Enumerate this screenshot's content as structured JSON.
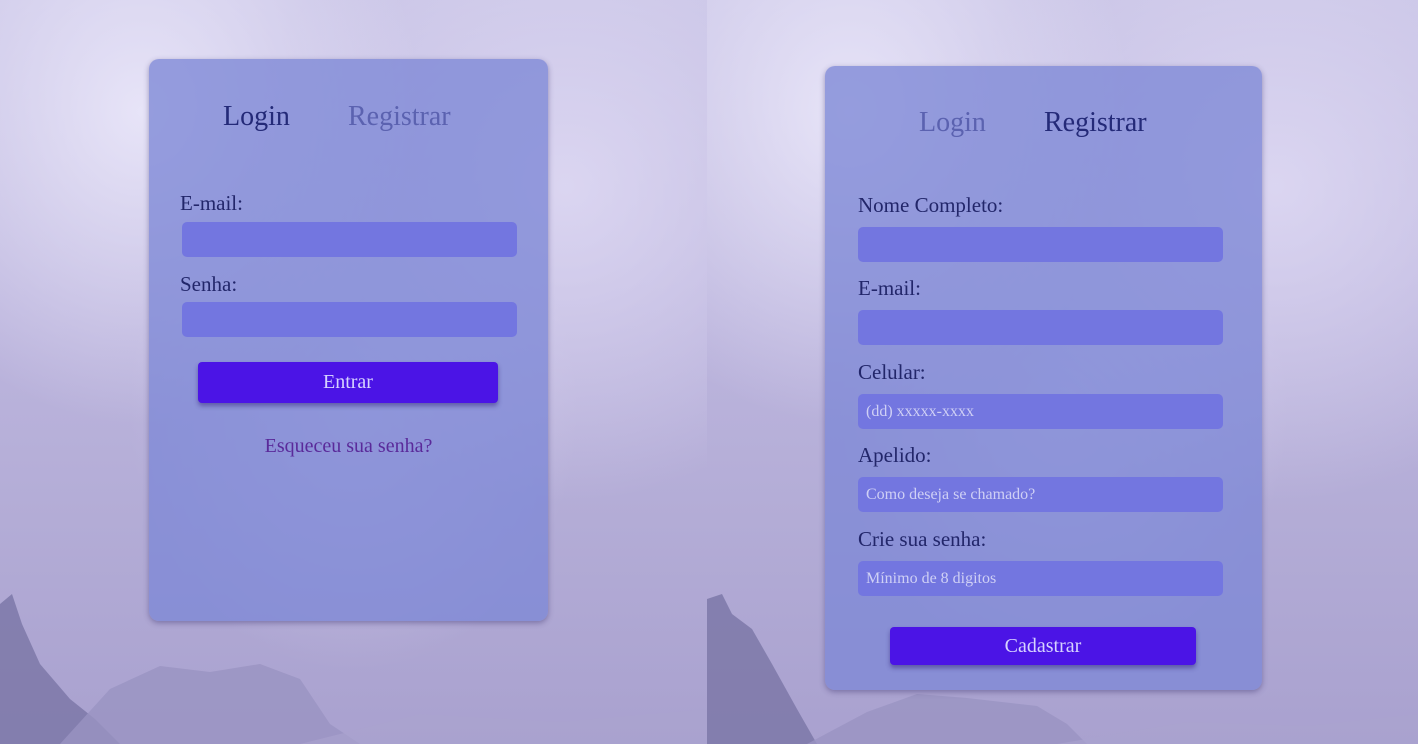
{
  "login_view": {
    "tabs": {
      "login": "Login",
      "register": "Registrar"
    },
    "fields": {
      "email_label": "E-mail:",
      "email_value": "",
      "password_label": "Senha:",
      "password_value": ""
    },
    "submit_label": "Entrar",
    "forgot_link": "Esqueceu sua senha?"
  },
  "register_view": {
    "tabs": {
      "login": "Login",
      "register": "Registrar"
    },
    "fields": {
      "fullname_label": "Nome Completo:",
      "fullname_placeholder": "",
      "email_label": "E-mail:",
      "email_placeholder": "",
      "phone_label": "Celular:",
      "phone_placeholder": "(dd) xxxxx-xxxx",
      "nickname_label": "Apelido:",
      "nickname_placeholder": "Como deseja se chamado?",
      "password_label": "Crie sua senha:",
      "password_placeholder": "Mínimo de 8 digitos"
    },
    "submit_label": "Cadastrar"
  },
  "colors": {
    "card": "#7e88d6",
    "input": "#7376e0",
    "button": "#4b14e6",
    "tab_active": "#242a78",
    "tab_inactive": "#5b62b0",
    "link": "#5a2a9a"
  }
}
